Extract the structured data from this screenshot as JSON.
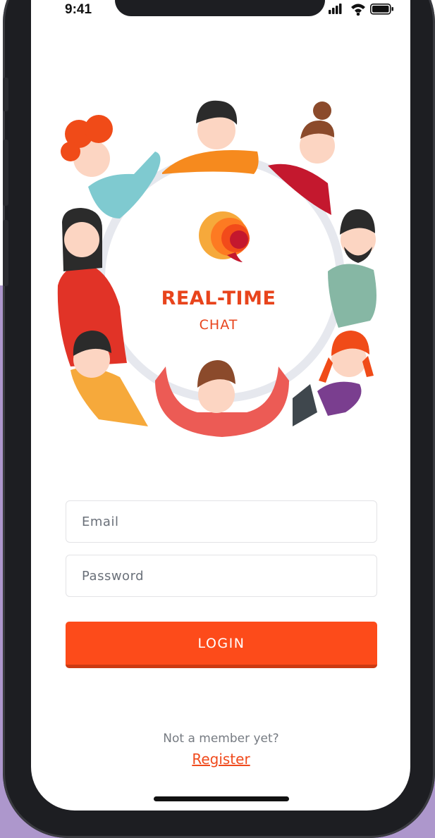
{
  "status_bar": {
    "time": "9:41",
    "icons": [
      "signal-icon",
      "wifi-icon",
      "battery-icon"
    ]
  },
  "brand": {
    "title": "REAL-TIME",
    "subtitle": "CHAT",
    "logo_icon": "chat-bubble-logo-icon",
    "color": "#e8441c"
  },
  "login_form": {
    "email_placeholder": "Email",
    "email_value": "",
    "password_placeholder": "Password",
    "password_value": "",
    "login_label": "LOGIN"
  },
  "footer": {
    "prompt": "Not a member yet?",
    "register_label": "Register"
  },
  "colors": {
    "accent": "#fd4b1a",
    "backdrop": "#ad97cc",
    "phone_frame": "#1d1e22"
  }
}
